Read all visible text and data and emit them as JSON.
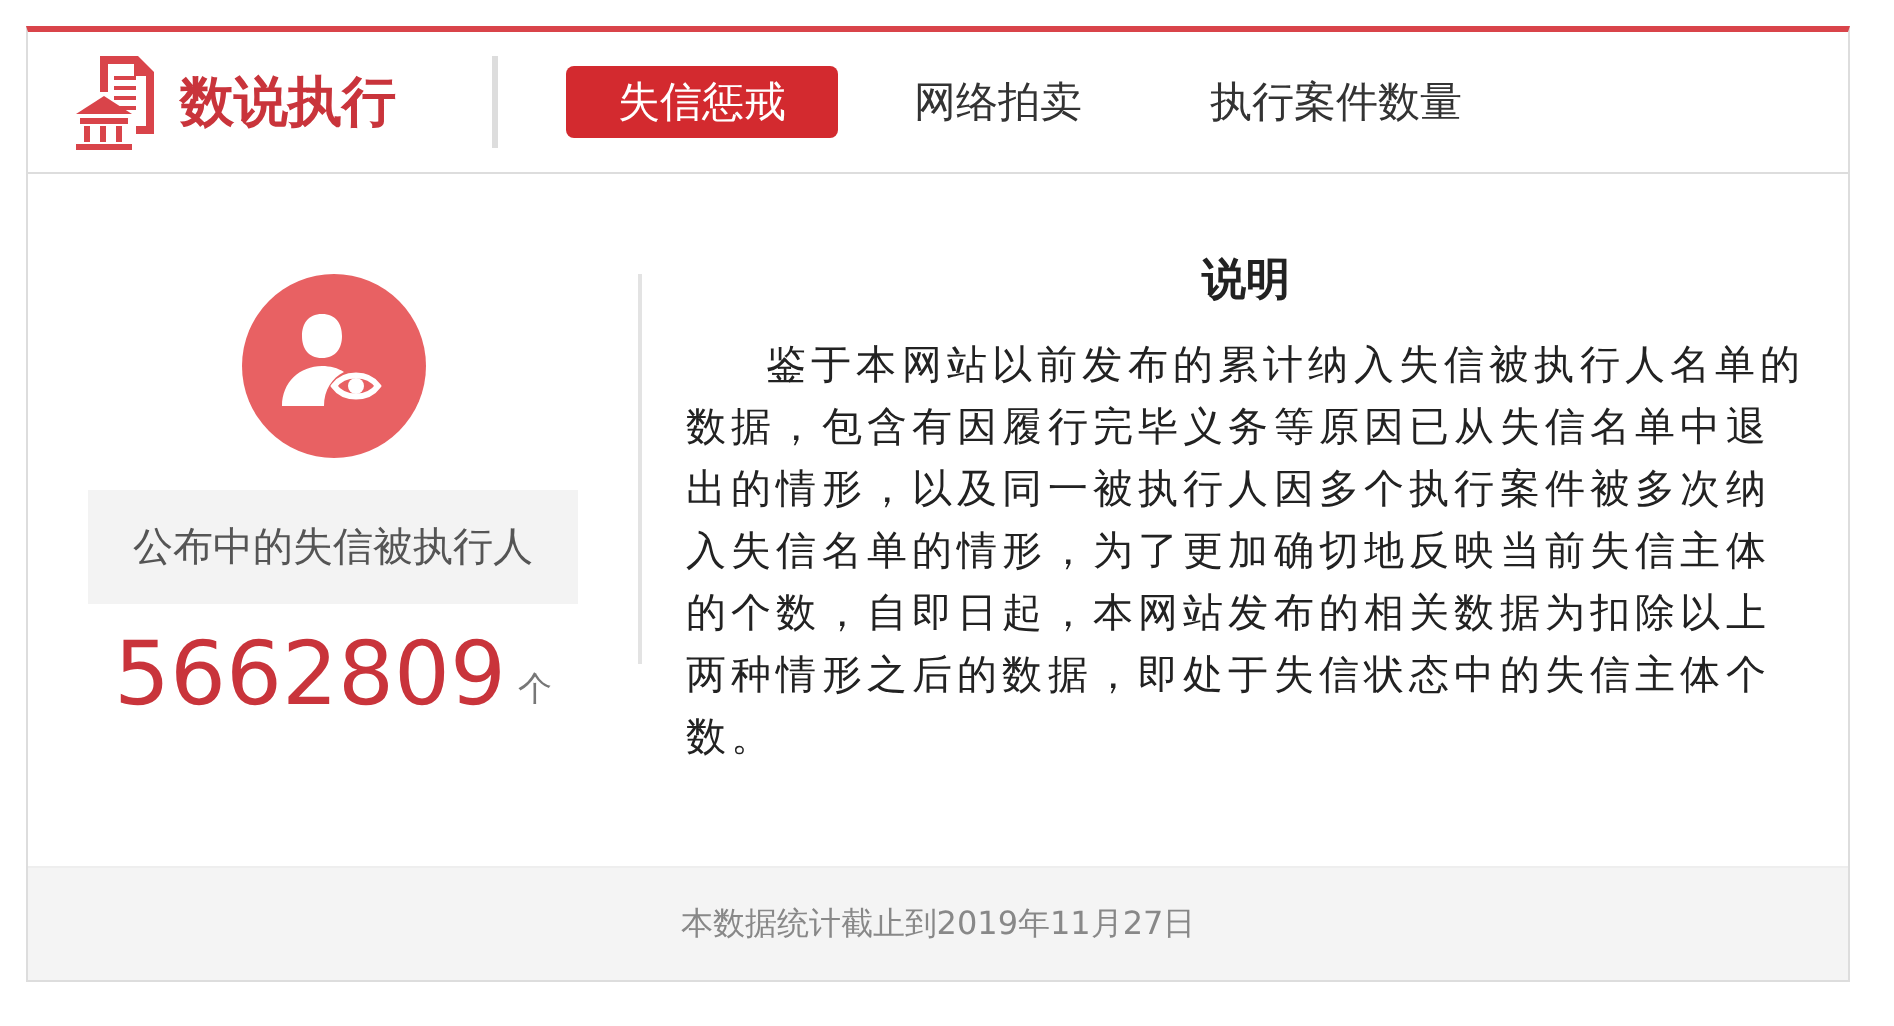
{
  "header": {
    "title": "数说执行",
    "tabs": [
      {
        "label": "失信惩戒",
        "selected": true
      },
      {
        "label": "网络拍卖",
        "selected": false
      },
      {
        "label": "执行案件数量",
        "selected": false
      }
    ]
  },
  "stat": {
    "label": "公布中的失信被执行人",
    "value": "5662809",
    "unit": "个"
  },
  "notice": {
    "title": "说明",
    "text": "鉴于本网站以前发布的累计纳入失信被执行人名单的数据，包含有因履行完毕义务等原因已从失信名单中退出的情形，以及同一被执行人因多个执行案件被多次纳入失信名单的情形，为了更加确切地反映当前失信主体的个数，自即日起，本网站发布的相关数据为扣除以上两种情形之后的数据，即处于失信状态中的失信主体个数。"
  },
  "footer": "本数据统计截止到2019年11月27日"
}
